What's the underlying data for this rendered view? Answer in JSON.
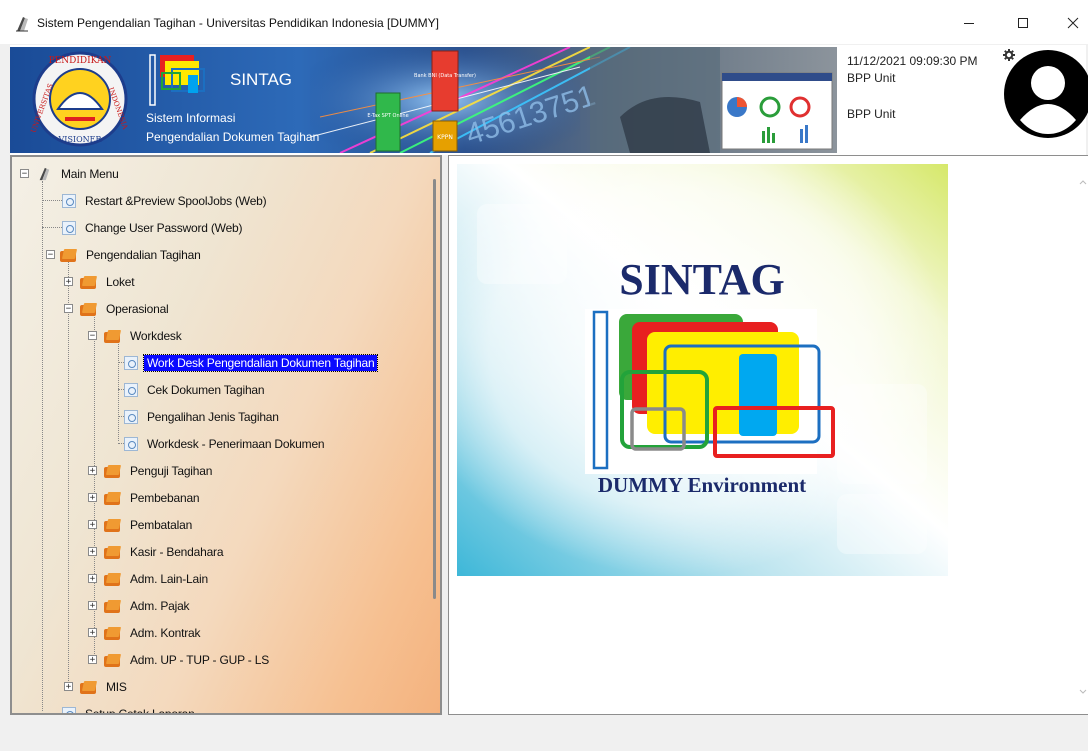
{
  "window": {
    "title": "Sistem Pengendalian Tagihan - Universitas Pendidikan Indonesia [DUMMY]",
    "minimize_icon": "minimize-icon",
    "maximize_icon": "maximize-icon",
    "close_icon": "close-icon"
  },
  "header": {
    "banner": {
      "app_name": "SINTAG",
      "subtitle_line1": "Sistem Informasi",
      "subtitle_line2": "Pengendalian Dokumen Tagihan",
      "seal_top": "PENDIDIKAN",
      "seal_left": "UNIVERSITAS",
      "seal_right": "INDONESIA",
      "seal_bottom": "VISIONER",
      "tile_labels": [
        "Bank BNI (Data Transfer)",
        "KPPN",
        "E-Tax SPT Online"
      ],
      "digits": "45613751"
    },
    "datetime": "11/12/2021 09:09:30 PM",
    "user_unit_1": "BPP Unit",
    "user_unit_2": "BPP Unit",
    "settings_icon": "gear-icon",
    "avatar_icon": "user-avatar-icon"
  },
  "tree": {
    "root": "Main Menu",
    "items": [
      {
        "label": "Restart &Preview SpoolJobs (Web)"
      },
      {
        "label": "Change User Password (Web)"
      },
      {
        "label": "Pengendalian Tagihan"
      },
      {
        "label": "Loket"
      },
      {
        "label": "Operasional"
      },
      {
        "label": "Workdesk"
      },
      {
        "label": "Work Desk Pengendalian Dokumen Tagihan"
      },
      {
        "label": "Cek Dokumen Tagihan"
      },
      {
        "label": "Pengalihan Jenis Tagihan"
      },
      {
        "label": "Workdesk - Penerimaan Dokumen"
      },
      {
        "label": "Penguji Tagihan"
      },
      {
        "label": "Pembebanan"
      },
      {
        "label": "Pembatalan"
      },
      {
        "label": "Kasir - Bendahara"
      },
      {
        "label": "Adm. Lain-Lain"
      },
      {
        "label": "Adm. Pajak"
      },
      {
        "label": "Adm. Kontrak"
      },
      {
        "label": "Adm. UP - TUP - GUP - LS"
      },
      {
        "label": "MIS"
      },
      {
        "label": "Setup Cetak Laporan"
      }
    ]
  },
  "splash": {
    "title": "SINTAG",
    "subtitle": "DUMMY Environment"
  },
  "colors": {
    "selection": "#0a0aff",
    "folder": "#e0731a",
    "splash_title": "#1b2a6b"
  }
}
